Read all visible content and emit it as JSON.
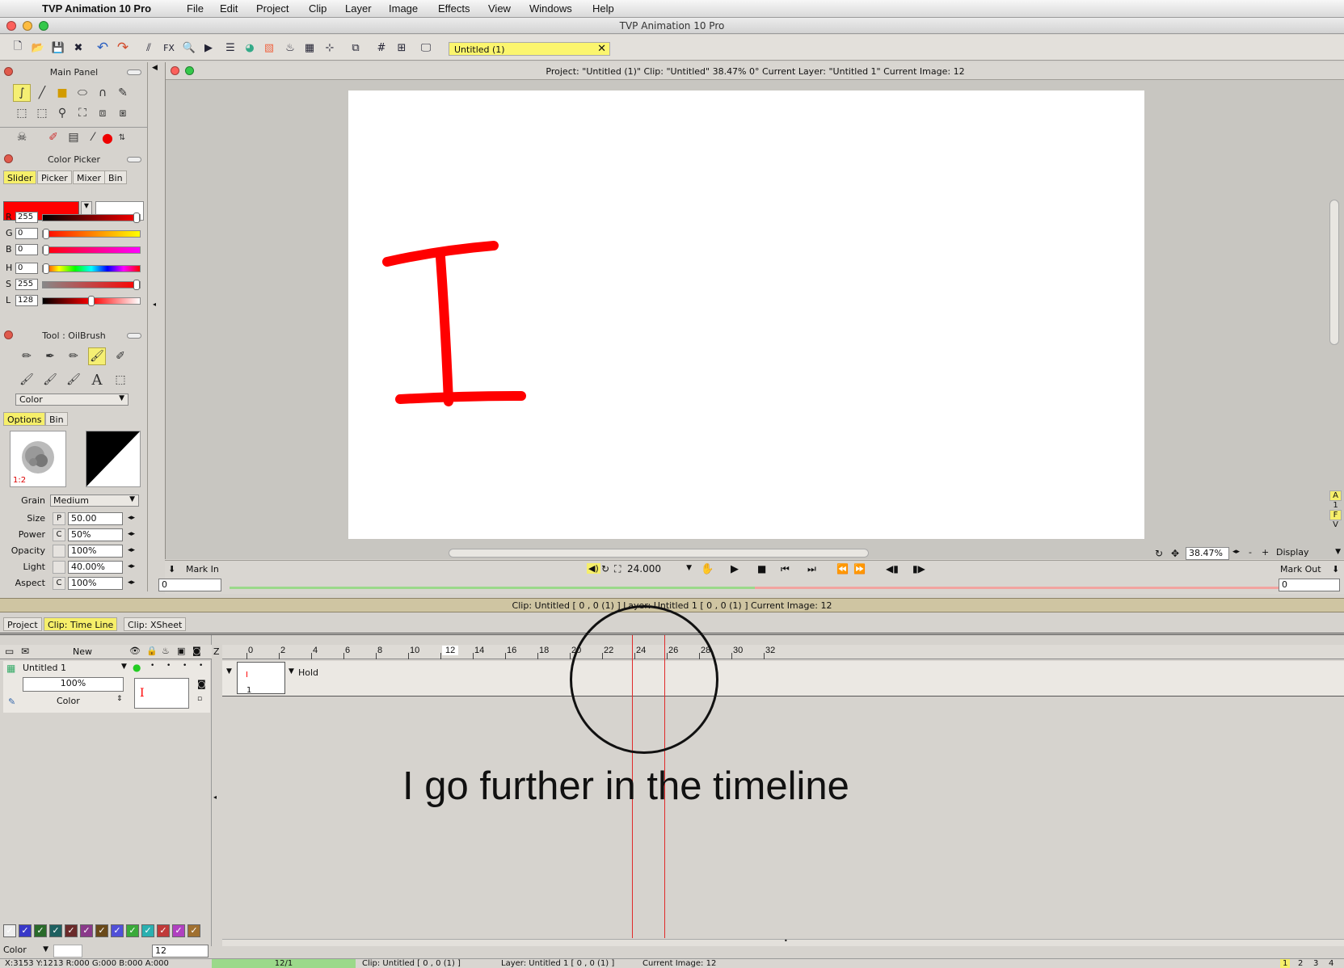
{
  "menubar": {
    "apple": "",
    "app_name": "TVP Animation 10 Pro",
    "items": [
      "File",
      "Edit",
      "Project",
      "Clip",
      "Layer",
      "Image",
      "Effects",
      "View",
      "Windows",
      "Help"
    ]
  },
  "window": {
    "title": "TVP Animation 10 Pro"
  },
  "toolbar": {
    "fx_label": "FX",
    "doc_tab": "Untitled (1)",
    "doc_tab_close": "✕"
  },
  "main_panel": {
    "title": "Main Panel"
  },
  "color_picker": {
    "title": "Color Picker",
    "tabs": [
      "Slider",
      "Picker",
      "Mixer",
      "Bin"
    ],
    "primary_color": "#ff0000",
    "secondary_color": "#ffffff",
    "channels": [
      {
        "label": "R",
        "value": "255",
        "fraction": 1.0
      },
      {
        "label": "G",
        "value": "0",
        "fraction": 0.0
      },
      {
        "label": "B",
        "value": "0",
        "fraction": 0.0
      },
      {
        "label": "H",
        "value": "0",
        "fraction": 0.0
      },
      {
        "label": "S",
        "value": "255",
        "fraction": 1.0
      },
      {
        "label": "L",
        "value": "128",
        "fraction": 0.5
      }
    ]
  },
  "tool_panel": {
    "title": "Tool : OilBrush",
    "mode_select": "Color",
    "tabs": [
      "Options",
      "Bin"
    ],
    "brush_ratio": "1:2",
    "grain_label": "Grain",
    "grain_value": "Medium",
    "params": [
      {
        "label": "Size",
        "flag": "P",
        "value": "50.00"
      },
      {
        "label": "Power",
        "flag": "C",
        "value": "50%"
      },
      {
        "label": "Opacity",
        "flag": "",
        "value": "100%"
      },
      {
        "label": "Light",
        "flag": "",
        "value": "40.00%"
      },
      {
        "label": "Aspect",
        "flag": "C",
        "value": "100%"
      }
    ]
  },
  "viewport": {
    "info": "Project:  \"Untitled (1)\"  Clip: \"Untitled\"   38.47%   0°   Current Layer: \"Untitled 1\"  Current Image: 12",
    "zoom": "38.47%",
    "display_label": "Display",
    "side_letters": [
      "A",
      "1",
      "F",
      "V"
    ]
  },
  "playbar": {
    "mark_in_label": "Mark In",
    "mark_in_value": "0",
    "fps": "24.000",
    "mark_out_label": "Mark Out",
    "mark_out_value": "0"
  },
  "clip_header": {
    "text": "Clip: Untitled [ 0 , 0  (1) ]        Layer: Untitled 1 [ 0 , 0  (1) ]    Current Image: 12"
  },
  "clip_tabs": [
    "Project",
    "Clip: Time Line",
    "Clip: XSheet"
  ],
  "timeline": {
    "new_label": "New",
    "z_label": "Z",
    "layer_name": "Untitled 1",
    "layer_opacity": "100%",
    "layer_mode": "Color",
    "hold_label": "Hold",
    "frame_number": "1",
    "current_frame": "12",
    "ruler_labels": [
      "0",
      "2",
      "4",
      "6",
      "8",
      "10",
      "12",
      "14",
      "16",
      "18",
      "20",
      "22",
      "24",
      "26",
      "28",
      "30",
      "32"
    ],
    "bottom_mode": "Color",
    "frame_input": "12"
  },
  "annotation": {
    "text": "I go further in the timeline"
  },
  "statusbar": {
    "coords": "X:3153  Y:1213  R:000 G:000 B:000 A:000",
    "progress": "12/1",
    "clip": "Clip: Untitled [ 0 , 0  (1) ]",
    "layer": "Layer: Untitled 1 [ 0 , 0  (1) ]",
    "current": "Current Image: 12",
    "pages": [
      "1",
      "2",
      "3",
      "4"
    ]
  },
  "colors": {
    "accent_yellow": "#f6ef6a",
    "brush_red": "#ff0000",
    "playhead": "#e02a2a"
  }
}
